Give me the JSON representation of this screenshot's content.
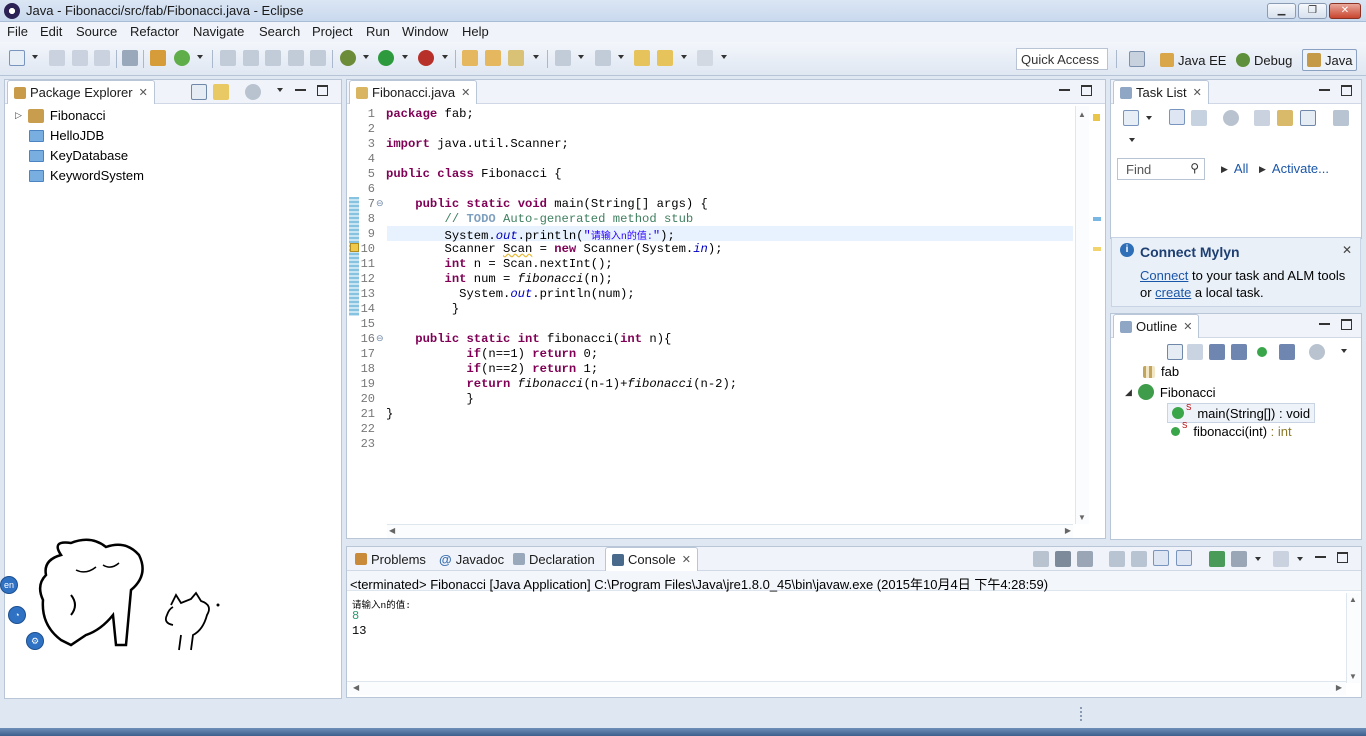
{
  "window": {
    "title": "Java - Fibonacci/src/fab/Fibonacci.java - Eclipse"
  },
  "menu": [
    "File",
    "Edit",
    "Source",
    "Refactor",
    "Navigate",
    "Search",
    "Project",
    "Run",
    "Window",
    "Help"
  ],
  "toolbar": {
    "quick_access": "Quick Access",
    "perspectives": [
      "Java EE",
      "Debug",
      "Java"
    ]
  },
  "package_explorer": {
    "title": "Package Explorer",
    "projects": [
      "Fibonacci",
      "HelloJDB",
      "KeyDatabase",
      "KeywordSystem"
    ]
  },
  "editor": {
    "tab": "Fibonacci.java",
    "line_numbers": [
      "1",
      "2",
      "3",
      "4",
      "5",
      "6",
      "7",
      "8",
      "9",
      "10",
      "11",
      "12",
      "13",
      "14",
      "15",
      "16",
      "17",
      "18",
      "19",
      "20",
      "21",
      "22",
      "23"
    ]
  },
  "task_list": {
    "title": "Task List",
    "find_placeholder": "Find",
    "all_label": "All",
    "activate_label": "Activate..."
  },
  "mylyn": {
    "title": "Connect Mylyn",
    "connect_link": "Connect",
    "text1": " to your task and ALM tools",
    "or": "or ",
    "create_link": "create",
    "text2": " a local task."
  },
  "outline": {
    "title": "Outline",
    "package": "fab",
    "class": "Fibonacci",
    "method1": "main(String[]) : void",
    "method2_name": "fibonacci(int)",
    "method2_type": " : int",
    "static_marker": "S"
  },
  "bottom": {
    "tabs": [
      "Problems",
      "Javadoc",
      "Declaration",
      "Console"
    ],
    "status": "<terminated> Fibonacci [Java Application] C:\\Program Files\\Java\\jre1.8.0_45\\bin\\javaw.exe (2015年10月4日 下午4:28:59)",
    "output_prompt": "请输入n的值:",
    "output_input": "8",
    "output_result": "13"
  },
  "widgets": {
    "lang": "en"
  }
}
